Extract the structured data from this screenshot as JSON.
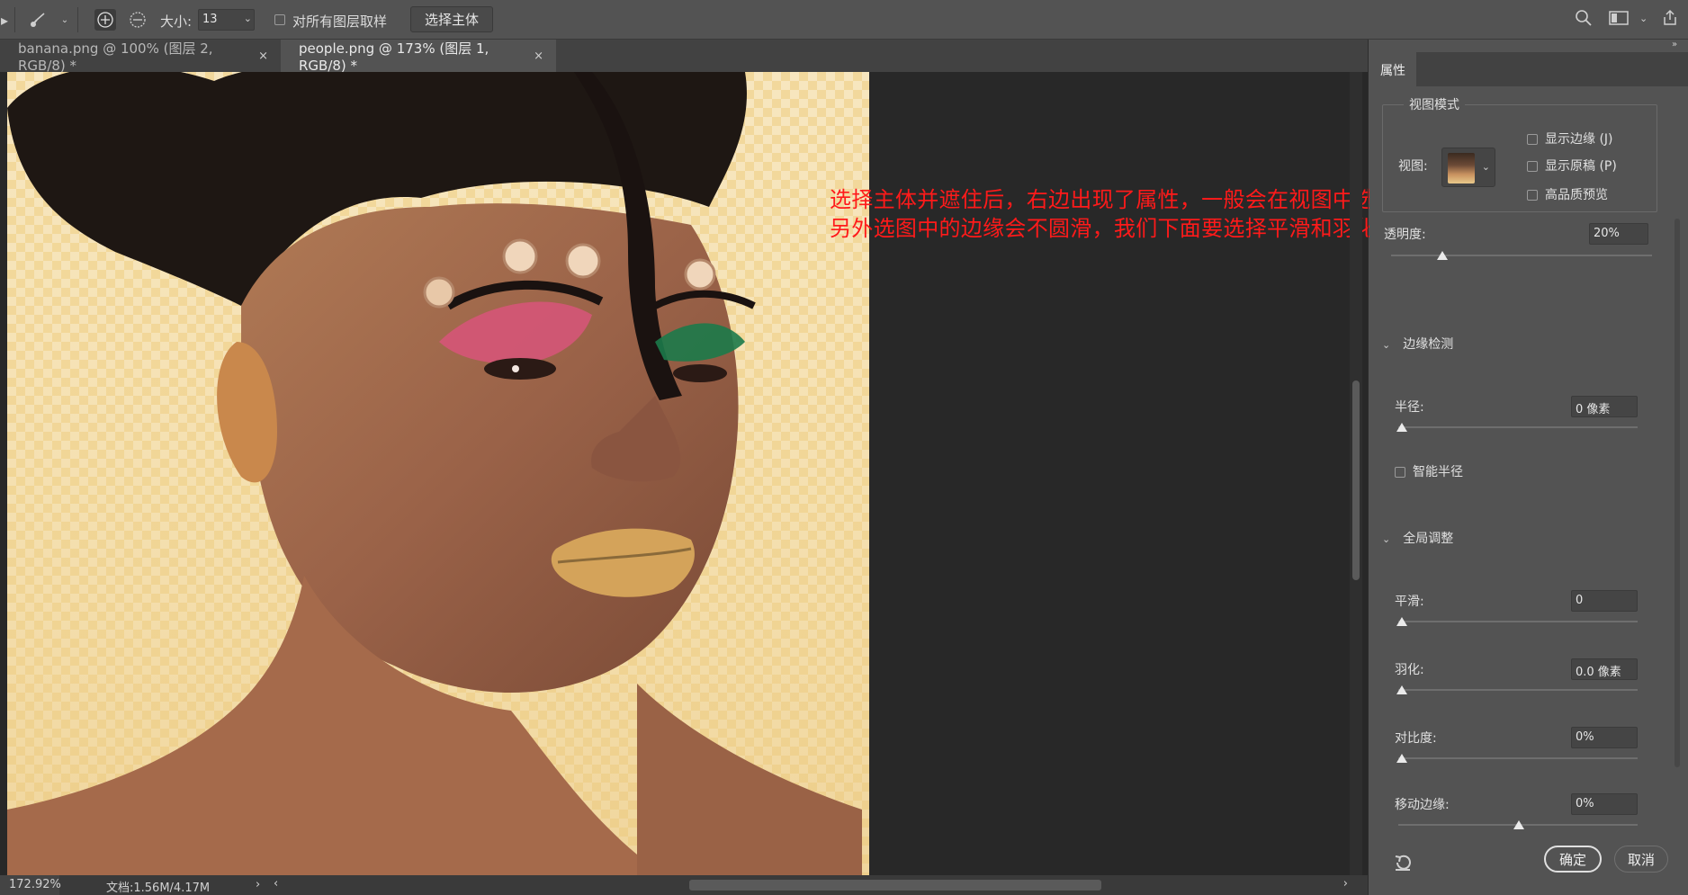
{
  "options_bar": {
    "size_label": "大小:",
    "size_value": "13",
    "sample_all_layers_label": "对所有图层取样",
    "select_subject_button": "选择主体"
  },
  "tabs": [
    {
      "label": "banana.png @ 100% (图层 2, RGB/8) *",
      "close": "×",
      "active": false
    },
    {
      "label": "people.png @ 173% (图层 1, RGB/8) *",
      "close": "×",
      "active": true
    }
  ],
  "annotation": {
    "line1": "选择主体并遮住后，右边出现了属性，一般会在视图中选择一个容易区分的背景颜色",
    "line2": "另外选图中的边缘会不圆滑，我们下面要选择平滑和羽化功能"
  },
  "status": {
    "zoom": "172.92%",
    "doc": "文档:1.56M/4.17M",
    "arrow": "›",
    "scroll_left": "‹",
    "scroll_right": "›"
  },
  "panel": {
    "tab_label": "属性",
    "view_mode": {
      "title": "视图模式",
      "view_label": "视图:",
      "show_edge": "显示边缘 (J)",
      "show_original": "显示原稿 (P)",
      "high_quality": "高品质预览"
    },
    "opacity": {
      "label": "透明度:",
      "value": "20%",
      "level_percent": 20
    },
    "edge_detection": {
      "title": "边缘检测",
      "radius_label": "半径:",
      "radius_value": "0 像素",
      "smart_radius_label": "智能半径"
    },
    "global_refine": {
      "title": "全局调整",
      "smooth_label": "平滑:",
      "smooth_value": "0",
      "feather_label": "羽化:",
      "feather_value": "0.0 像素",
      "contrast_label": "对比度:",
      "contrast_value": "0%",
      "shift_edge_label": "移动边缘:",
      "shift_edge_value": "0%"
    },
    "ok_button": "确定",
    "cancel_button": "取消"
  }
}
